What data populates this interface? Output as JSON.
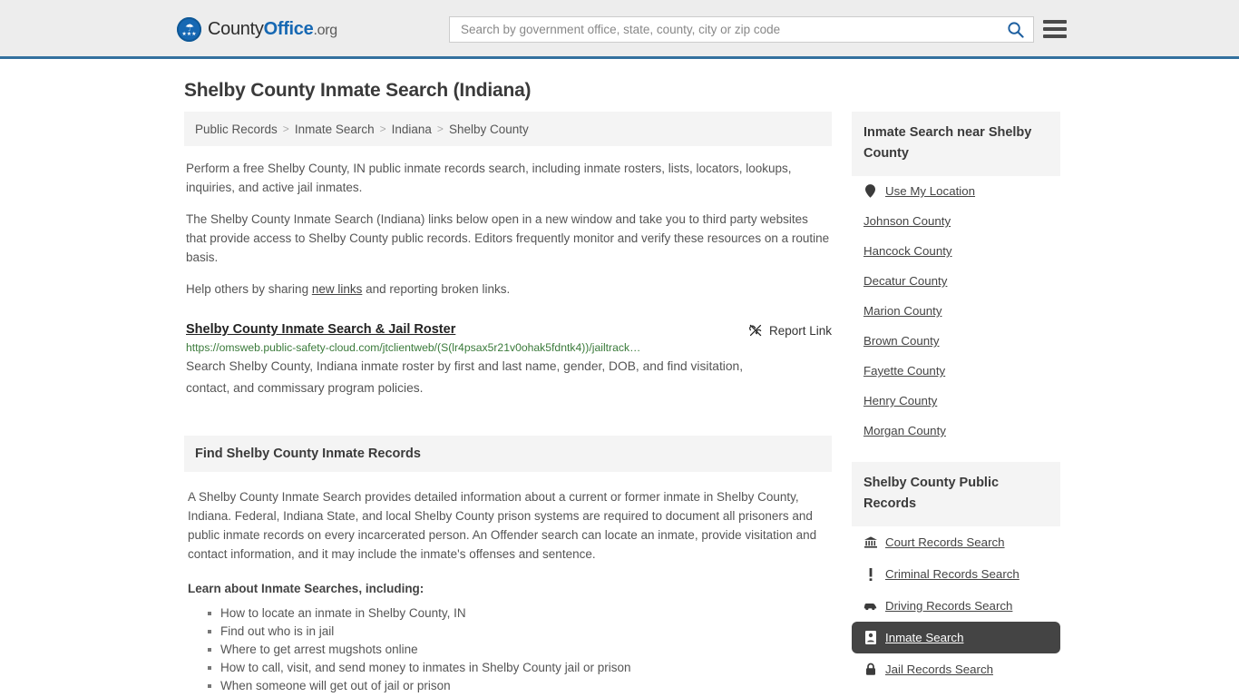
{
  "header": {
    "brand": {
      "word1": "County",
      "word2": "Office",
      "word3": ".org"
    },
    "search": {
      "placeholder": "Search by government office, state, county, city or zip code",
      "value": "",
      "button_icon": "search-icon"
    },
    "menu_icon": "hamburger-menu-icon",
    "accent_color": "#33719f"
  },
  "page": {
    "title": "Shelby County Inmate Search (Indiana)"
  },
  "breadcrumb": {
    "separator": ">",
    "items": [
      {
        "label": "Public Records"
      },
      {
        "label": "Inmate Search"
      },
      {
        "label": "Indiana"
      },
      {
        "label": "Shelby County"
      }
    ]
  },
  "intro": {
    "p1": "Perform a free Shelby County, IN public inmate records search, including inmate rosters, lists, locators, lookups, inquiries, and active jail inmates.",
    "p2": "The Shelby County Inmate Search (Indiana) links below open in a new window and take you to third party websites that provide access to Shelby County public records. Editors frequently monitor and verify these resources on a routine basis.",
    "p3_before": "Help others by sharing ",
    "p3_link": "new links",
    "p3_after": " and reporting broken links."
  },
  "result": {
    "title": "Shelby County Inmate Search & Jail Roster",
    "report_label": "Report Link",
    "report_icon": "broken-link-icon",
    "url": "https://omsweb.public-safety-cloud.com/jtclientweb/(S(lr4psax5r21v0ohak5fdntk4))/jailtrack…",
    "description": "Search Shelby County, Indiana inmate roster by first and last name, gender, DOB, and find visitation, contact, and commissary program policies."
  },
  "section": {
    "heading": "Find Shelby County Inmate Records",
    "paragraph": "A Shelby County Inmate Search provides detailed information about a current or former inmate in Shelby County, Indiana. Federal, Indiana State, and local Shelby County prison systems are required to document all prisoners and public inmate records on every incarcerated person. An Offender search can locate an inmate, provide visitation and contact information, and it may include the inmate's offenses and sentence.",
    "learn_label": "Learn about Inmate Searches, including:",
    "bullets": [
      "How to locate an inmate in Shelby County, IN",
      "Find out who is in jail",
      "Where to get arrest mugshots online",
      "How to call, visit, and send money to inmates in Shelby County jail or prison",
      "When someone will get out of jail or prison"
    ]
  },
  "sidebar": {
    "nearby": {
      "heading": "Inmate Search near Shelby County",
      "items": [
        {
          "label": "Use My Location",
          "icon": "location-pin-icon"
        },
        {
          "label": "Johnson County",
          "icon": ""
        },
        {
          "label": "Hancock County",
          "icon": ""
        },
        {
          "label": "Decatur County",
          "icon": ""
        },
        {
          "label": "Marion County",
          "icon": ""
        },
        {
          "label": "Brown County",
          "icon": ""
        },
        {
          "label": "Fayette County",
          "icon": ""
        },
        {
          "label": "Henry County",
          "icon": ""
        },
        {
          "label": "Morgan County",
          "icon": ""
        }
      ]
    },
    "records": {
      "heading": "Shelby County Public Records",
      "items": [
        {
          "label": "Court Records Search",
          "icon": "courthouse-icon",
          "active": false
        },
        {
          "label": "Criminal Records Search",
          "icon": "exclamation-icon",
          "active": false
        },
        {
          "label": "Driving Records Search",
          "icon": "car-icon",
          "active": false
        },
        {
          "label": "Inmate Search",
          "icon": "id-badge-icon",
          "active": true
        },
        {
          "label": "Jail Records Search",
          "icon": "lock-icon",
          "active": false
        }
      ],
      "active_bg": "#444444"
    }
  }
}
